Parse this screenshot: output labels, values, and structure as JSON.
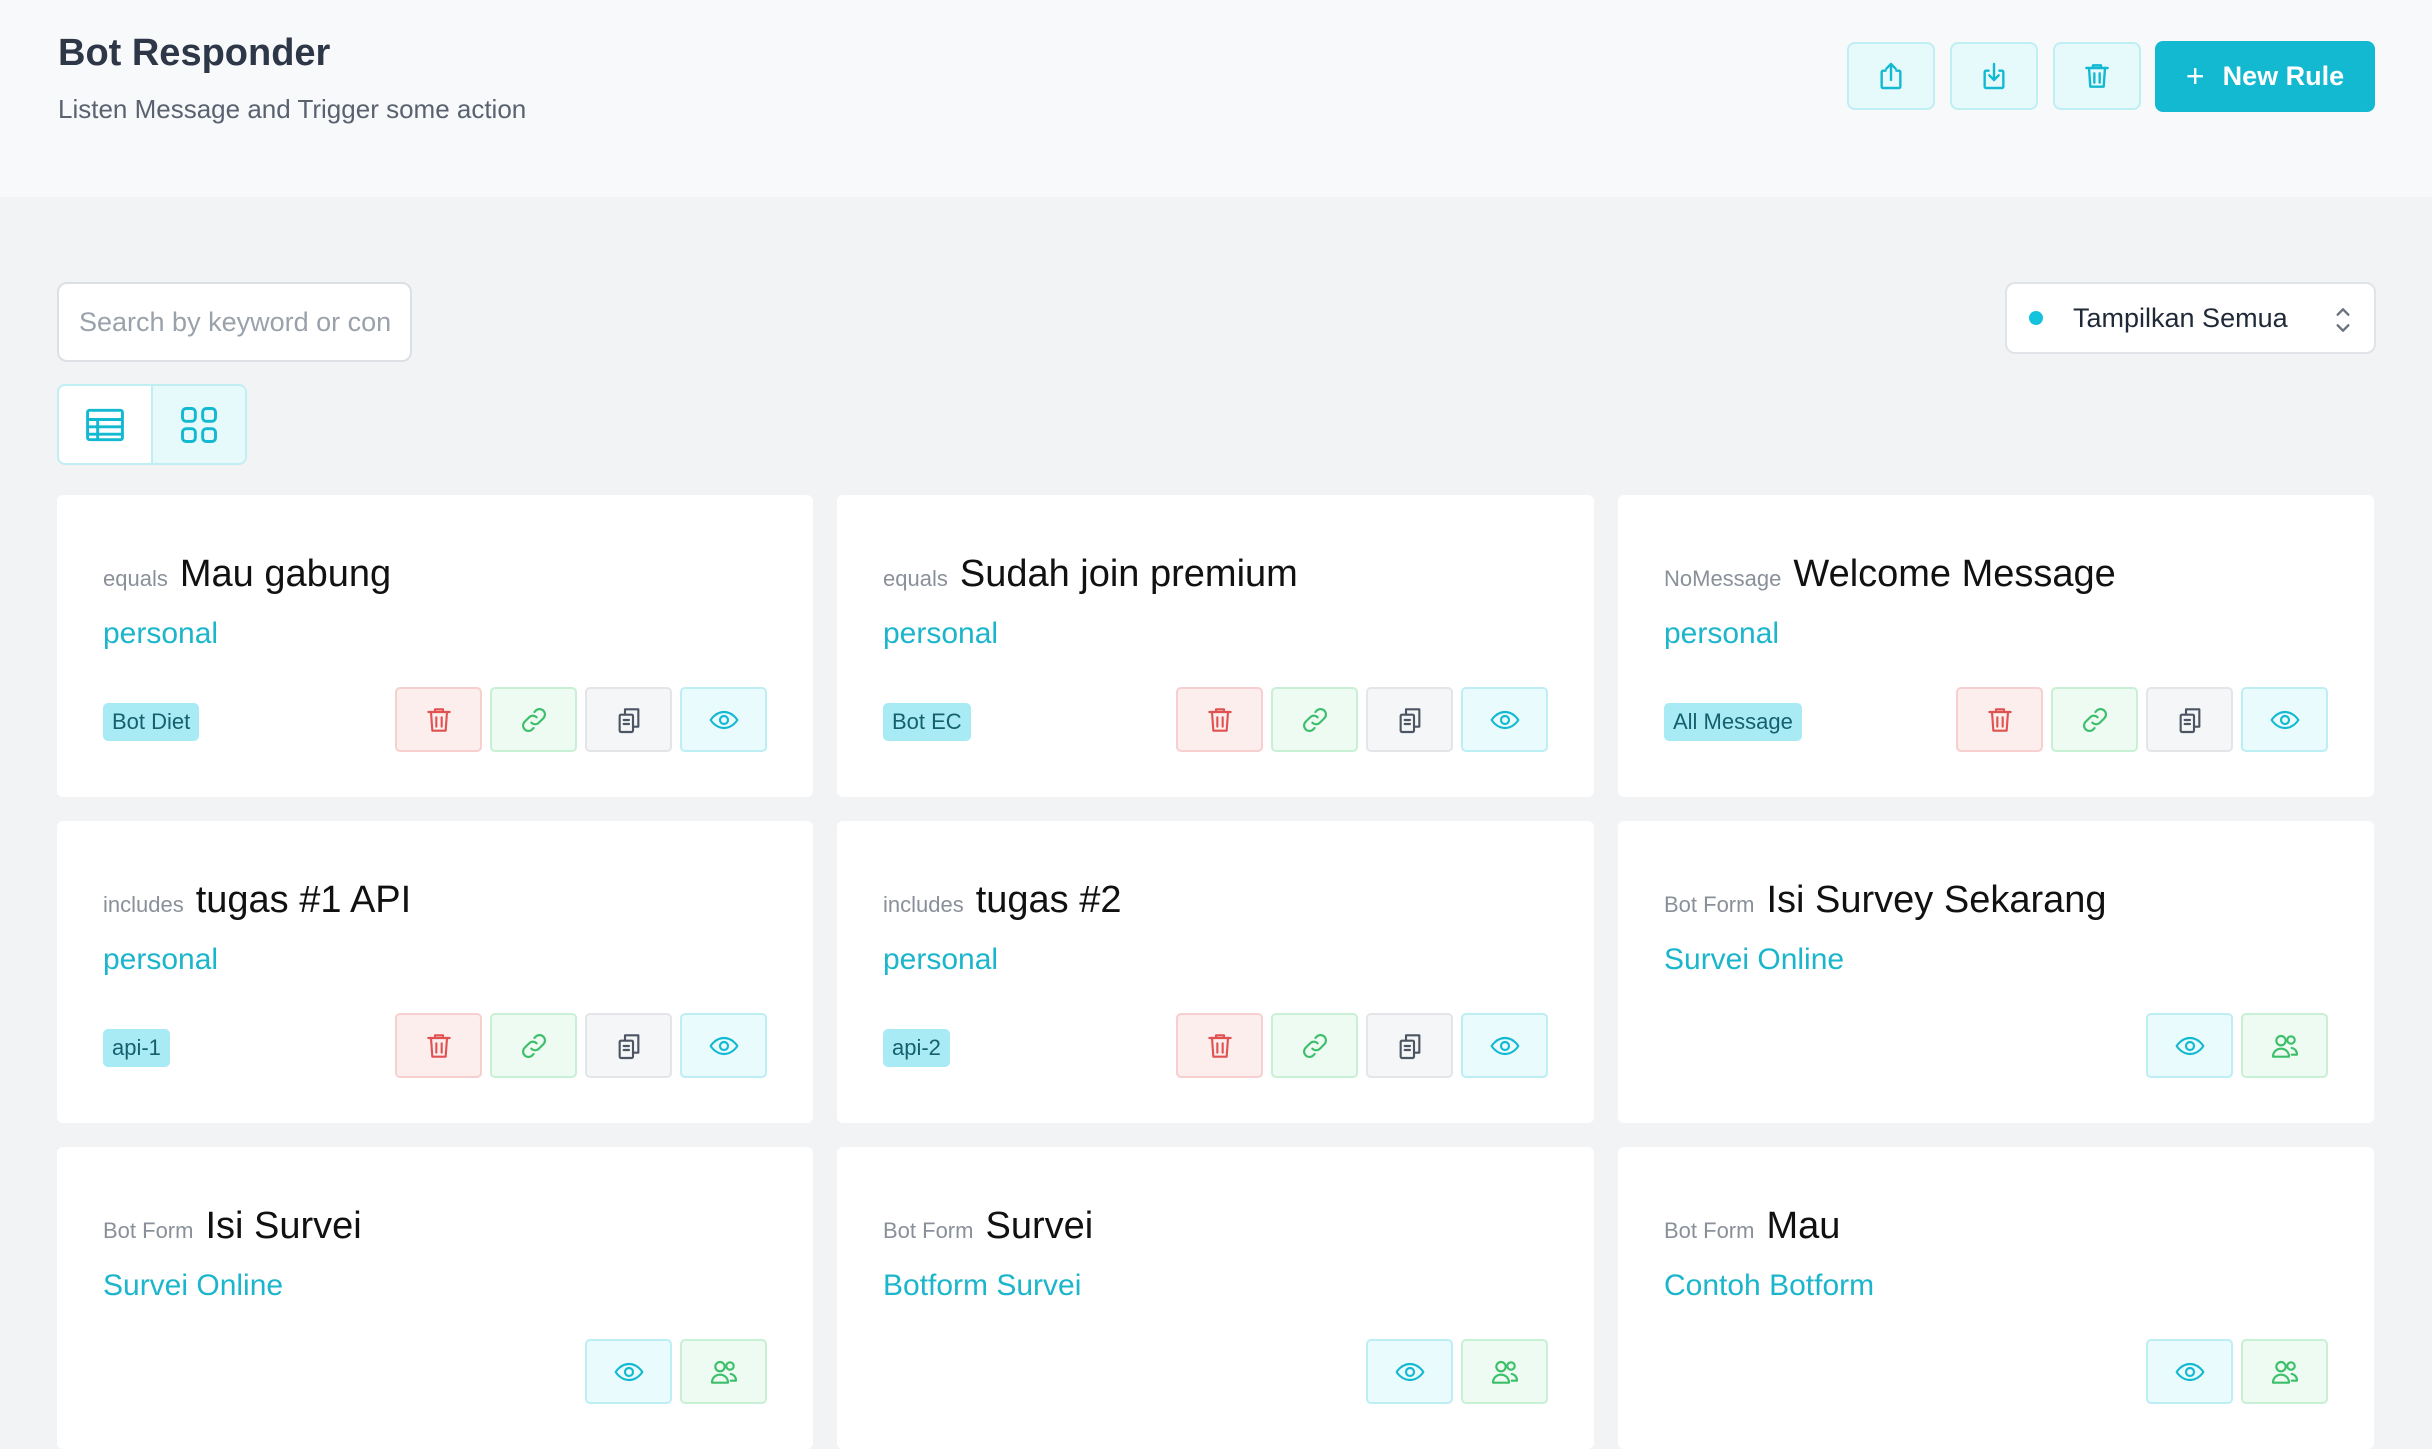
{
  "header": {
    "title": "Bot Responder",
    "subtitle": "Listen Message and Trigger some action",
    "new_rule_label": "New Rule"
  },
  "search": {
    "placeholder": "Search by keyword or cont",
    "value": ""
  },
  "filter": {
    "label": "Tampilkan Semua"
  },
  "colors": {
    "accent": "#13b9d1",
    "delete": "#e05252",
    "link": "#3cbf6a"
  },
  "cards": [
    {
      "type": "equals",
      "name": "Mau gabung",
      "owner": "personal",
      "tag": "Bot Diet"
    },
    {
      "type": "equals",
      "name": "Sudah join premium",
      "owner": "personal",
      "tag": "Bot EC"
    },
    {
      "type": "NoMessage",
      "name": "Welcome Message",
      "owner": "personal",
      "tag": "All Message"
    },
    {
      "type": "includes",
      "name": "tugas #1 API",
      "owner": "personal",
      "tag": "api-1"
    },
    {
      "type": "includes",
      "name": "tugas #2",
      "owner": "personal",
      "tag": "api-2"
    },
    {
      "type": "Bot Form",
      "name": "Isi Survey Sekarang",
      "owner": "Survei Online",
      "tag": ""
    },
    {
      "type": "Bot Form",
      "name": "Isi Survei",
      "owner": "Survei Online",
      "tag": ""
    },
    {
      "type": "Bot Form",
      "name": "Survei",
      "owner": "Botform Survei",
      "tag": ""
    },
    {
      "type": "Bot Form",
      "name": "Mau",
      "owner": "Contoh Botform",
      "tag": ""
    }
  ]
}
